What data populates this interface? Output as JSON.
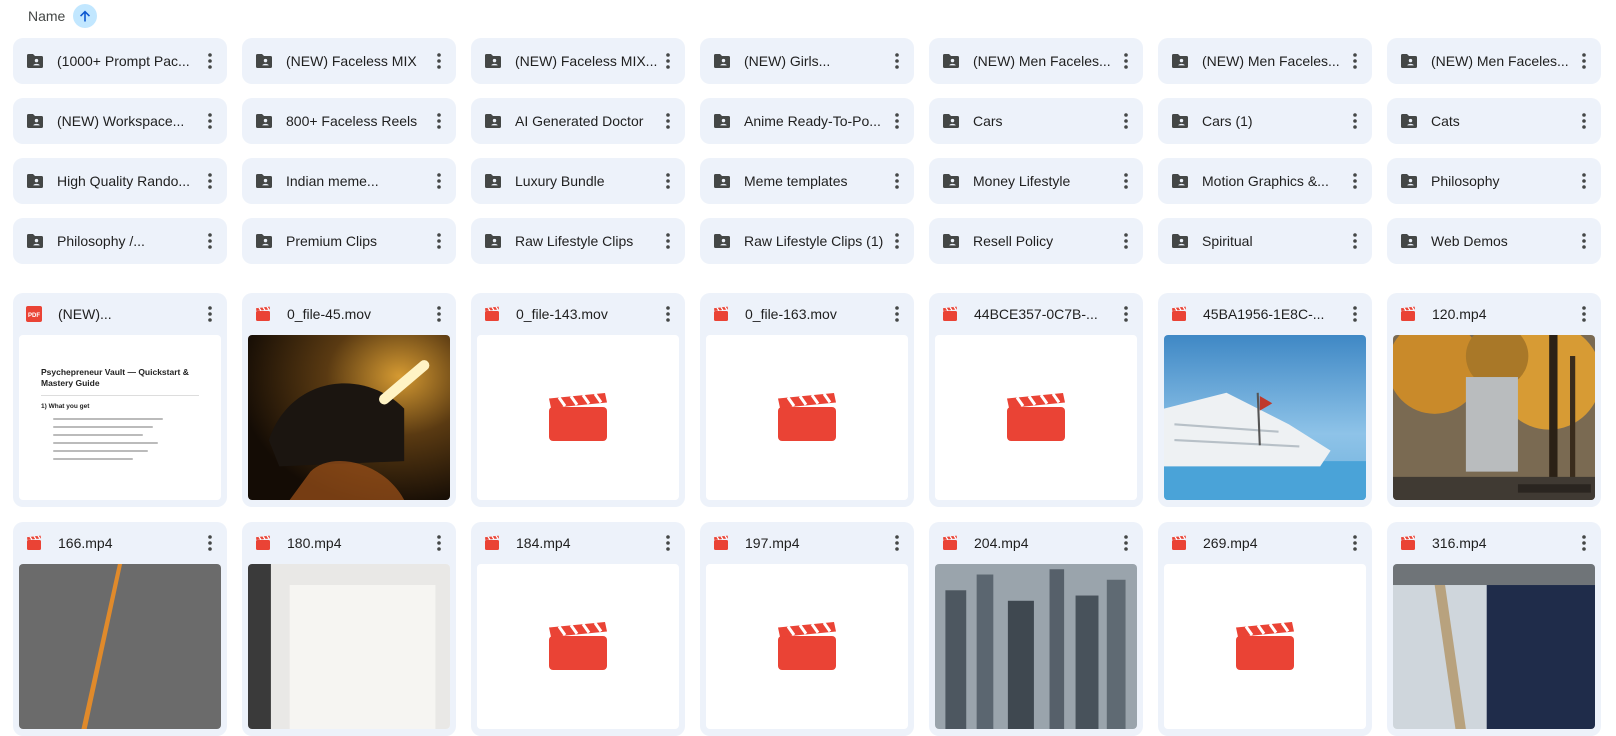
{
  "header": {
    "sort_label": "Name"
  },
  "folders": [
    "(1000+ Prompt Pac...",
    "(NEW) Faceless MIX",
    "(NEW) Faceless MIX...",
    "(NEW) Girls...",
    "(NEW) Men Faceles...",
    "(NEW) Men Faceles...",
    "(NEW) Men Faceles...",
    "(NEW) Workspace...",
    "800+ Faceless Reels",
    "AI Generated Doctor",
    "Anime Ready-To-Po...",
    "Cars",
    "Cars (1)",
    "Cats",
    "High Quality Rando...",
    "Indian meme...",
    "Luxury Bundle",
    "Meme templates",
    "Money Lifestyle",
    "Motion Graphics &...",
    "Philosophy",
    "Philosophy /...",
    "Premium Clips",
    "Raw Lifestyle Clips",
    "Raw Lifestyle Clips (1)",
    "Resell Policy",
    "Spiritual",
    "Web Demos"
  ],
  "files": [
    {
      "name": "(NEW)...",
      "type": "pdf",
      "type_label": "PDF",
      "thumb": "doc"
    },
    {
      "name": "0_file-45.mov",
      "type": "video",
      "thumb": "dark-helmet"
    },
    {
      "name": "0_file-143.mov",
      "type": "video",
      "thumb": "video-icon"
    },
    {
      "name": "0_file-163.mov",
      "type": "video",
      "thumb": "video-icon"
    },
    {
      "name": "44BCE357-0C7B-...",
      "type": "video",
      "thumb": "video-icon"
    },
    {
      "name": "45BA1956-1E8C-...",
      "type": "video",
      "thumb": "yacht"
    },
    {
      "name": "120.mp4",
      "type": "video",
      "thumb": "autumn-trees"
    },
    {
      "name": "166.mp4",
      "type": "video",
      "thumb": "grey-streak"
    },
    {
      "name": "180.mp4",
      "type": "video",
      "thumb": "white-box"
    },
    {
      "name": "184.mp4",
      "type": "video",
      "thumb": "video-icon"
    },
    {
      "name": "197.mp4",
      "type": "video",
      "thumb": "video-icon"
    },
    {
      "name": "204.mp4",
      "type": "video",
      "thumb": "city-skyline"
    },
    {
      "name": "269.mp4",
      "type": "video",
      "thumb": "video-icon"
    },
    {
      "name": "316.mp4",
      "type": "video",
      "thumb": "interior"
    }
  ],
  "pdf_preview": {
    "title": "Psychepreneur Vault — Quickstart & Mastery Guide",
    "section": "1) What you get"
  },
  "colors": {
    "card_bg": "#edf2fa",
    "video_red": "#ea4335",
    "sort_bubble": "#c2e7ff",
    "icon_grey": "#444746"
  }
}
